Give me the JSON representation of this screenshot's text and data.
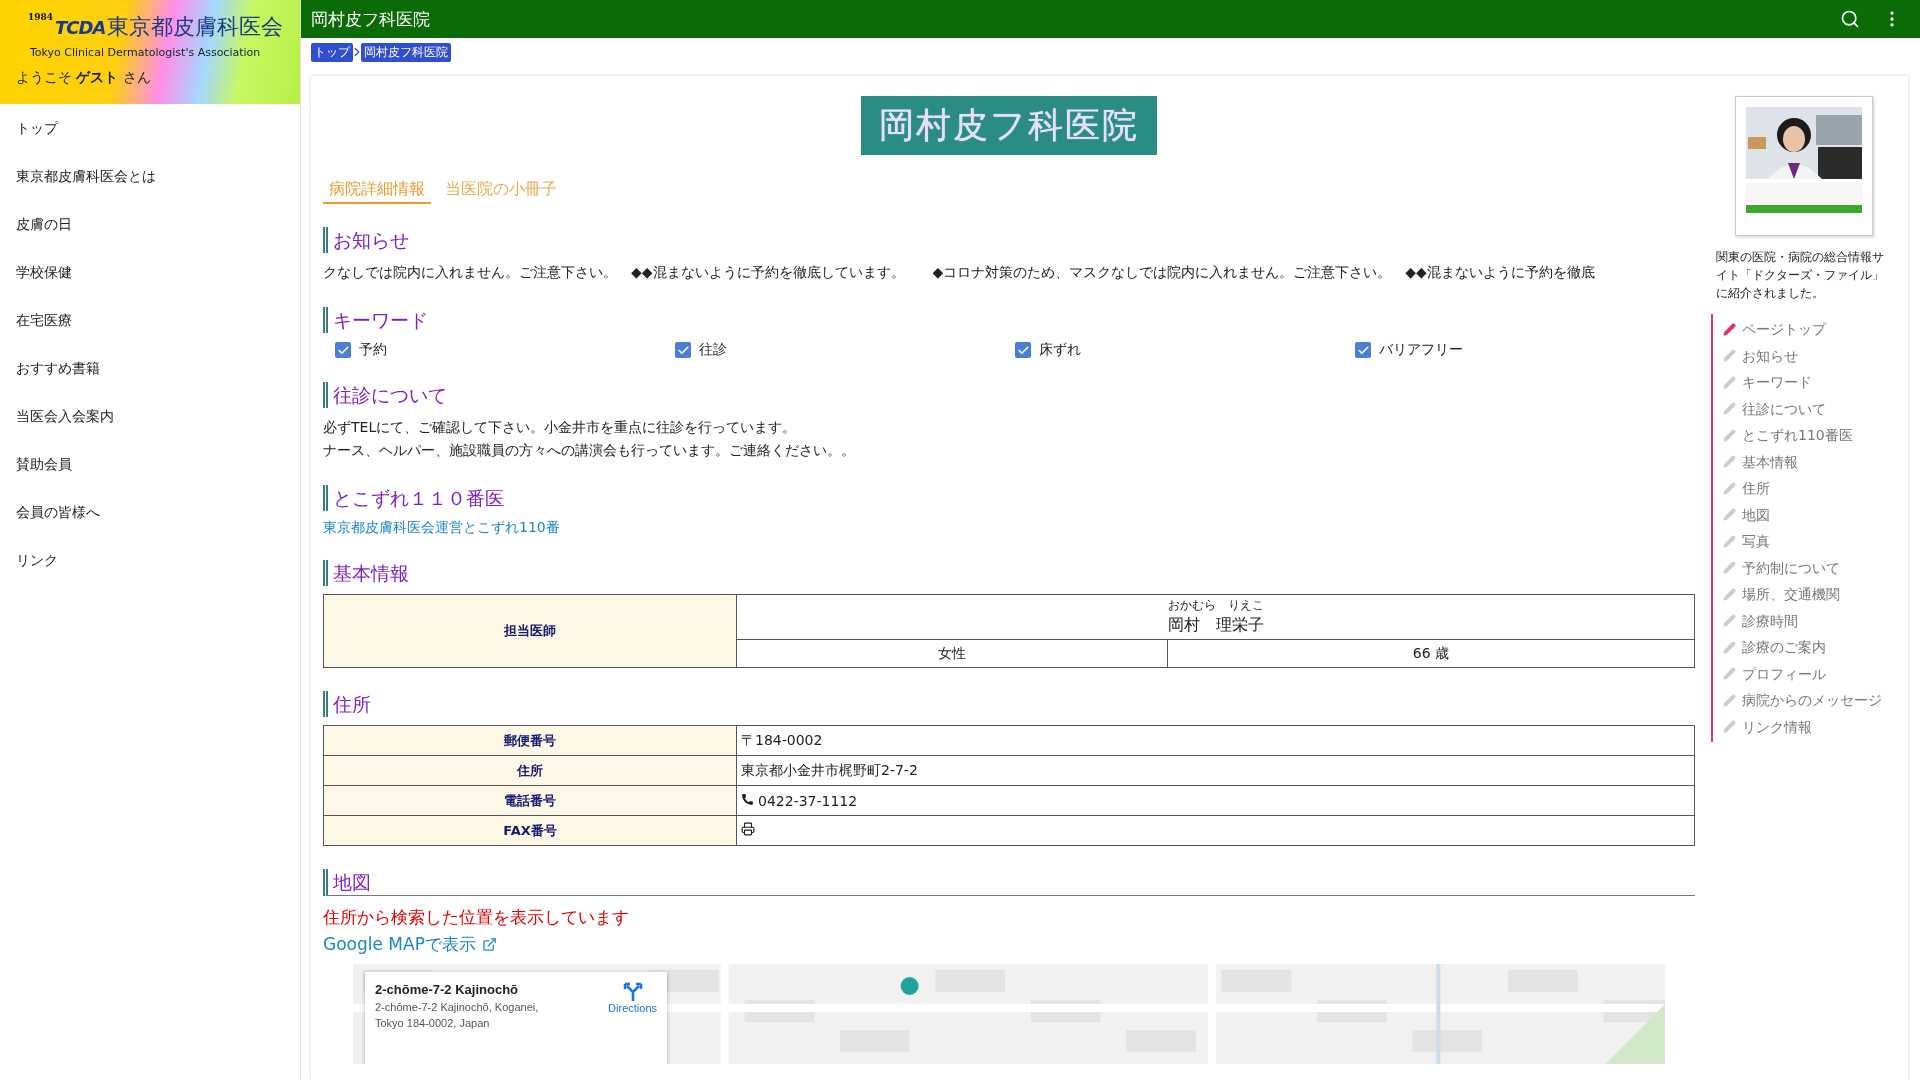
{
  "sidebar": {
    "logo": {
      "mark": "TCDA",
      "year": "1984",
      "title": "東京都皮膚科医会",
      "subtitle": "Tokyo Clinical Dermatologist's Association"
    },
    "welcome": "ようこそ **ゲスト** さん",
    "items": [
      "トップ",
      "東京都皮膚科医会とは",
      "皮膚の日",
      "学校保健",
      "在宅医療",
      "おすすめ書籍",
      "当医会入会案内",
      "賛助会員",
      "会員の皆様へ",
      "リンク"
    ]
  },
  "header": {
    "title": "岡村皮フ科医院"
  },
  "breadcrumb": [
    "トップ",
    "岡村皮フ科医院"
  ],
  "clinic_name": "岡村皮フ科医院",
  "tabs": [
    {
      "label": "病院詳細情報",
      "selected": true
    },
    {
      "label": "当医院の小冊子",
      "selected": false
    }
  ],
  "notice": {
    "heading": "お知らせ",
    "text": "クなしでは院内に入れません。ご注意下さい。　◆◆混まないように予約を徹底しています。　　◆コロナ対策のため、マスクなしでは院内に入れません。ご注意下さい。　◆◆混まないように予約を徹底"
  },
  "keywords": {
    "heading": "キーワード",
    "items": [
      {
        "label": "予約",
        "checked": true
      },
      {
        "label": "往診",
        "checked": true
      },
      {
        "label": "床ずれ",
        "checked": true
      },
      {
        "label": "バリアフリー",
        "checked": true
      }
    ]
  },
  "house_calls": {
    "heading": "往診について",
    "lines": [
      "必ずTELにて、ご確認して下さい。小金井市を重点に往診を行っています。",
      "ナース、ヘルパー、施設職員の方々への講演会も行っています。ご連絡ください。。"
    ]
  },
  "tokozure": {
    "heading": "とこずれ１１０番医",
    "link": "東京都皮膚科医会運営とこずれ110番"
  },
  "basic_info": {
    "heading": "基本情報",
    "label": "担当医師",
    "reading": "おかむら　りえこ",
    "name": "岡村　理栄子",
    "gender": "女性",
    "age": "66 歳"
  },
  "address": {
    "heading": "住所",
    "rows": [
      {
        "label": "郵便番号",
        "kind": "text",
        "value": "〒184-0002"
      },
      {
        "label": "住所",
        "kind": "text",
        "value": "東京都小金井市梶野町2-7-2"
      },
      {
        "label": "電話番号",
        "kind": "phone",
        "value": "0422-37-1112"
      },
      {
        "label": "FAX番号",
        "kind": "fax"
      }
    ]
  },
  "map": {
    "heading": "地図",
    "notice": "住所から検索した位置を表示しています",
    "link": "Google MAPで表示",
    "card": {
      "title": "2-chōme-7-2 Kajinochō",
      "address_lines": [
        "2-chōme-7-2 Kajinochō, Koganei,",
        "Tokyo 184-0002, Japan"
      ],
      "directions": "Directions"
    }
  },
  "aside": {
    "caption": "関東の医院・病院の総合情報サイト「ドクターズ・ファイル」に紹介されました。",
    "toc": [
      {
        "label": "ページトップ",
        "selected": true
      },
      {
        "label": "お知らせ",
        "selected": false
      },
      {
        "label": "キーワード",
        "selected": false
      },
      {
        "label": "往診について",
        "selected": false
      },
      {
        "label": "とこずれ110番医",
        "selected": false
      },
      {
        "label": "基本情報",
        "selected": false
      },
      {
        "label": "住所",
        "selected": false
      },
      {
        "label": "地図",
        "selected": false
      },
      {
        "label": "写真",
        "selected": false
      },
      {
        "label": "予約制について",
        "selected": false
      },
      {
        "label": "場所、交通機関",
        "selected": false
      },
      {
        "label": "診療時間",
        "selected": false
      },
      {
        "label": "診療のご案内",
        "selected": false
      },
      {
        "label": "プロフィール",
        "selected": false
      },
      {
        "label": "病院からのメッセージ",
        "selected": false
      },
      {
        "label": "リンク情報",
        "selected": false
      }
    ]
  }
}
